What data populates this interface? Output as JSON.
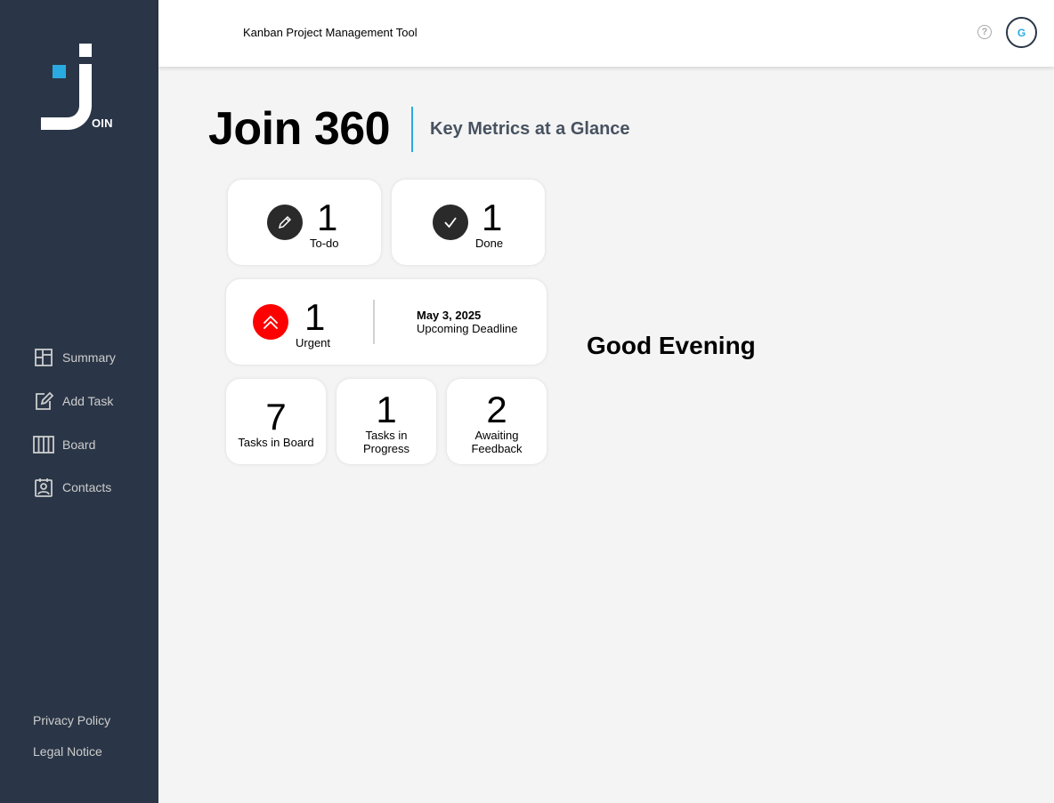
{
  "app": {
    "logo_suffix": "OIN",
    "header_title": "Kanban Project Management Tool",
    "help_icon": "question-mark-icon",
    "help_glyph": "?",
    "user_initial": "G"
  },
  "sidebar": {
    "items": [
      {
        "label": "Summary",
        "icon": "summary-icon"
      },
      {
        "label": "Add Task",
        "icon": "add-task-icon"
      },
      {
        "label": "Board",
        "icon": "board-icon"
      },
      {
        "label": "Contacts",
        "icon": "contacts-icon"
      }
    ],
    "footer": {
      "privacy_label": "Privacy Policy",
      "legal_label": "Legal Notice"
    }
  },
  "summary": {
    "title": "Join 360",
    "subtitle": "Key Metrics at a Glance",
    "todo": {
      "count": "1",
      "label": "To-do",
      "icon": "pencil-icon"
    },
    "done": {
      "count": "1",
      "label": "Done",
      "icon": "checkmark-icon"
    },
    "urgent": {
      "count": "1",
      "label": "Urgent",
      "icon": "double-chevron-up-icon"
    },
    "deadline": {
      "date": "May 3, 2025",
      "label": "Upcoming Deadline"
    },
    "tasks_in_board": {
      "count": "7",
      "label": "Tasks in Board"
    },
    "tasks_in_progress": {
      "count": "1",
      "label_line1": "Tasks in",
      "label_line2": "Progress"
    },
    "awaiting_feedback": {
      "count": "2",
      "label_line1": "Awaiting",
      "label_line2": "Feedback"
    },
    "greeting": "Good Evening"
  },
  "colors": {
    "sidebar_bg": "#2a3647",
    "accent": "#29abe2",
    "urgent": "#ff0000",
    "icon_dark": "#2a2a2a"
  }
}
